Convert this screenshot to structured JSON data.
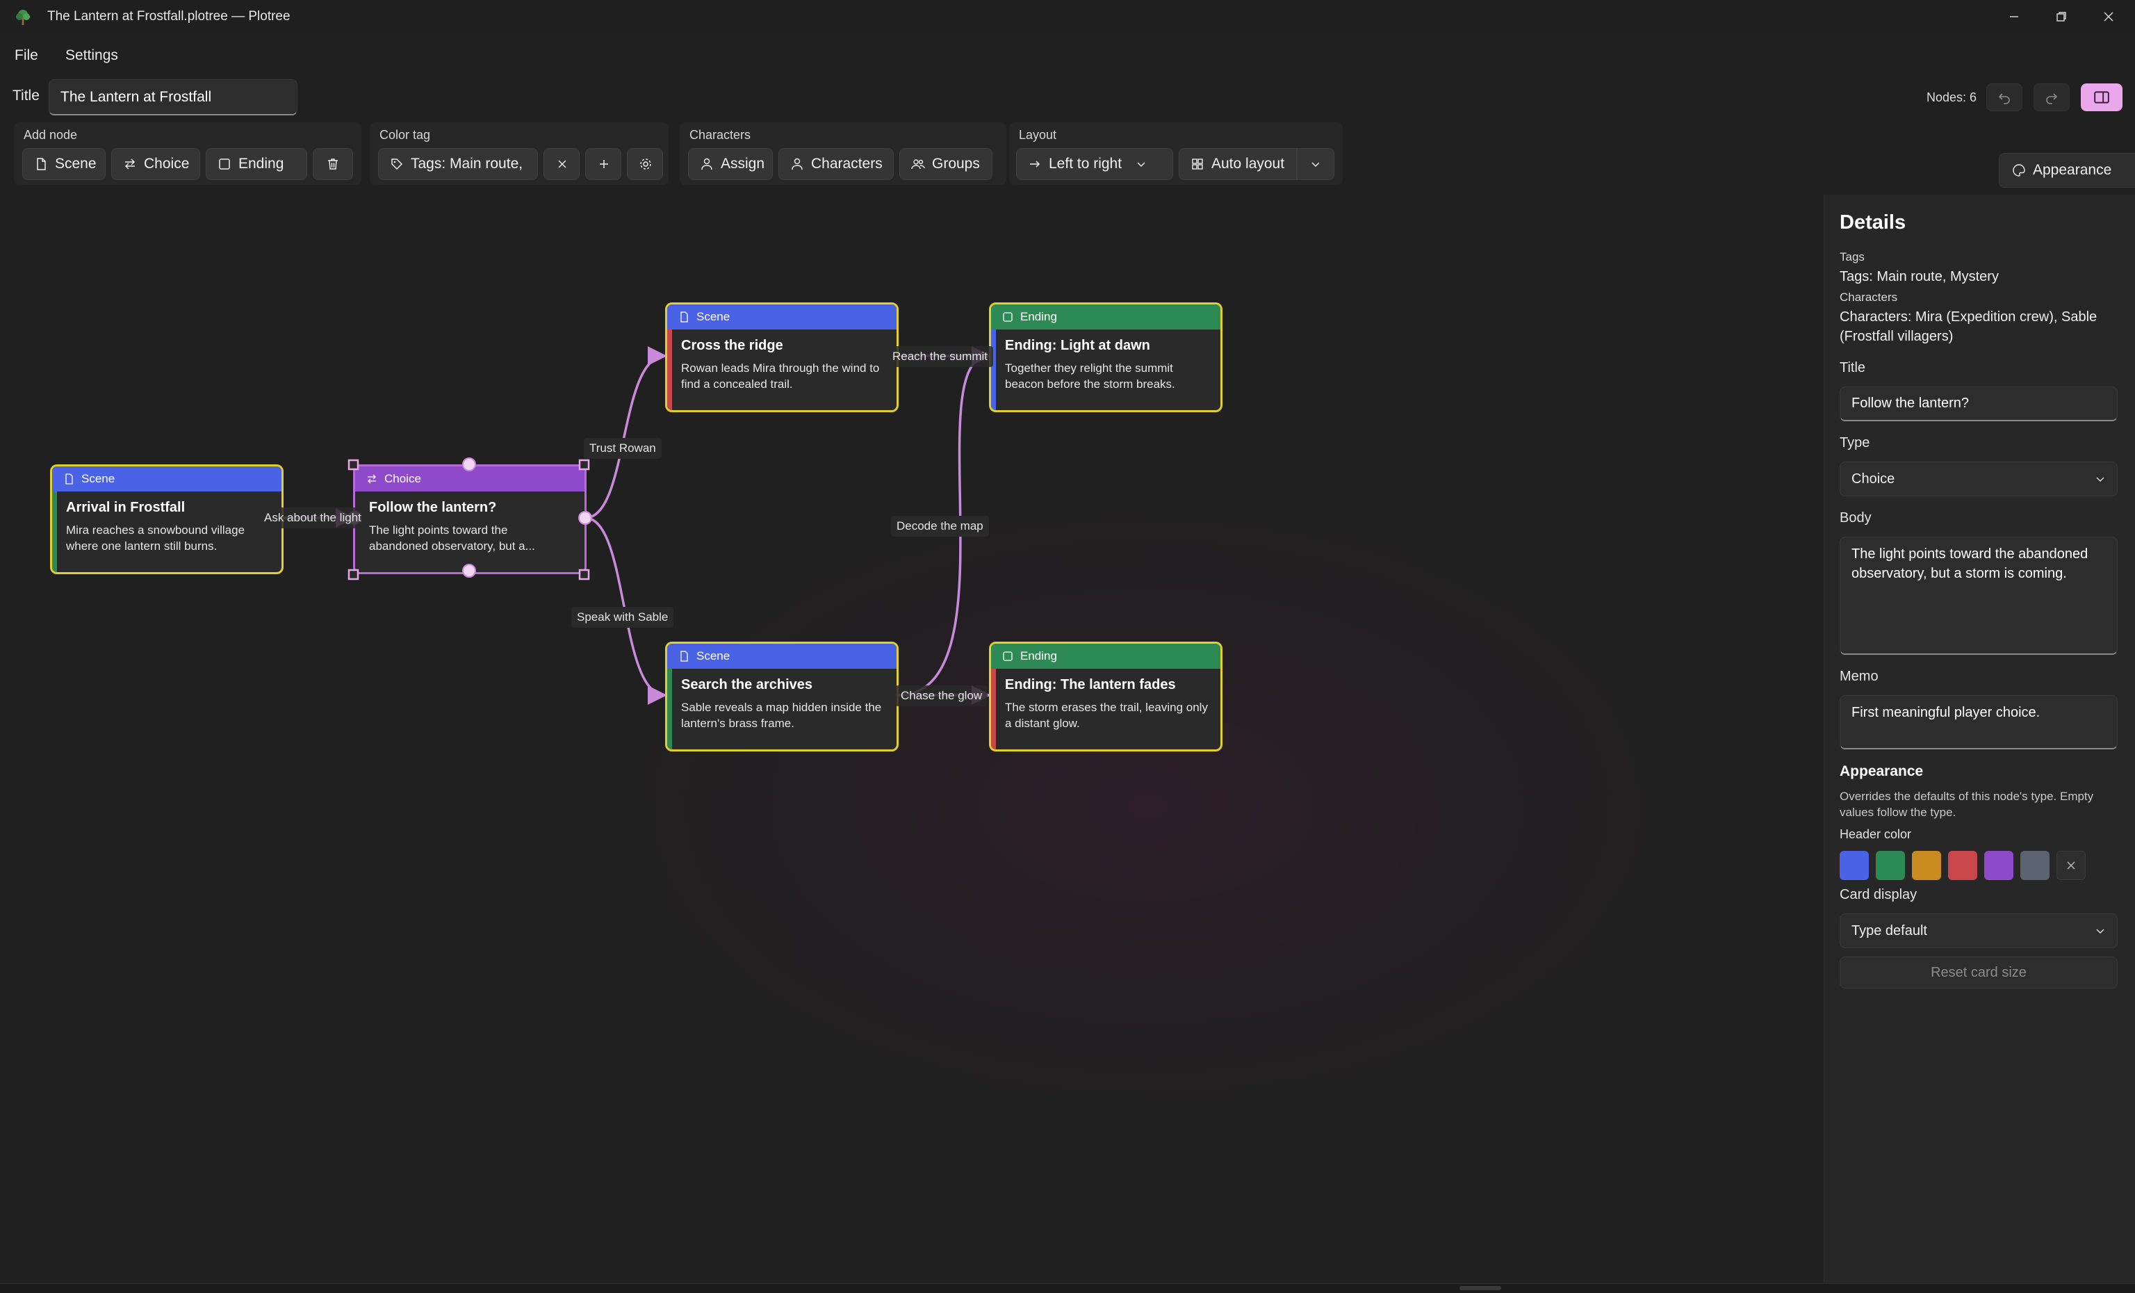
{
  "window": {
    "title": "The Lantern at Frostfall.plotree — Plotree",
    "icons": [
      "app-tree-icon",
      "minimize-icon",
      "restore-icon",
      "close-icon"
    ]
  },
  "menu": {
    "file": "File",
    "settings": "Settings"
  },
  "document": {
    "title_label": "Title",
    "title_value": "The Lantern at Frostfall"
  },
  "status": {
    "nodes_count": "Nodes: 6"
  },
  "toolbar": {
    "add_node": {
      "label": "Add node",
      "scene": "Scene",
      "choice": "Choice",
      "ending": "Ending"
    },
    "color_tag": {
      "label": "Color tag",
      "tags": "Tags: Main route,"
    },
    "characters": {
      "label": "Characters",
      "assign": "Assign",
      "characters": "Characters",
      "groups": "Groups"
    },
    "layout": {
      "label": "Layout",
      "direction": "Left to right",
      "auto": "Auto layout"
    },
    "appearance": "Appearance"
  },
  "colors": {
    "scene": "#4a63e6",
    "choice": "#8f4ac9",
    "ending": "#2e8a55",
    "highlight": "#e0cf2c",
    "edge": "#c98ad9",
    "accent_toggle": "#e9a6ea"
  },
  "nodes": [
    {
      "type": "Scene",
      "title": "Arrival in Frostfall",
      "body": "Mira reaches a snowbound village where one lantern still burns."
    },
    {
      "type": "Choice",
      "title": "Follow the lantern?",
      "body": "The light points toward the abandoned observatory, but a..."
    },
    {
      "type": "Scene",
      "title": "Cross the ridge",
      "body": "Rowan leads Mira through the wind to find a concealed trail."
    },
    {
      "type": "Scene",
      "title": "Search the archives",
      "body": "Sable reveals a map hidden inside the lantern's brass frame."
    },
    {
      "type": "Ending",
      "title": "Ending: Light at dawn",
      "body": "Together they relight the summit beacon before the storm breaks."
    },
    {
      "type": "Ending",
      "title": "Ending: The lantern fades",
      "body": "The storm erases the trail, leaving only a distant glow."
    }
  ],
  "edges": {
    "ask": "Ask about the light",
    "trust": "Trust Rowan",
    "speak": "Speak with Sable",
    "reach": "Reach the summit",
    "decode": "Decode the map",
    "chase": "Chase the glow"
  },
  "details": {
    "heading": "Details",
    "tags_label": "Tags",
    "tags_value": "Tags: Main route, Mystery",
    "characters_label": "Characters",
    "characters_value": "Characters: Mira (Expedition crew), Sable (Frostfall villagers)",
    "title_label": "Title",
    "title_value": "Follow the lantern?",
    "type_label": "Type",
    "type_value": "Choice",
    "body_label": "Body",
    "body_value": "The light points toward the abandoned observatory, but a storm is coming.",
    "memo_label": "Memo",
    "memo_value": "First meaningful player choice.",
    "appearance_heading": "Appearance",
    "appearance_note": "Overrides the defaults of this node's type. Empty values follow the type.",
    "header_color_label": "Header color",
    "header_colors": [
      "#4a63e6",
      "#2e8a55",
      "#c98a1f",
      "#c8474b",
      "#8f4ac9",
      "#5b6270"
    ],
    "card_display_label": "Card display",
    "card_display_value": "Type default",
    "reset": "Reset card size"
  }
}
